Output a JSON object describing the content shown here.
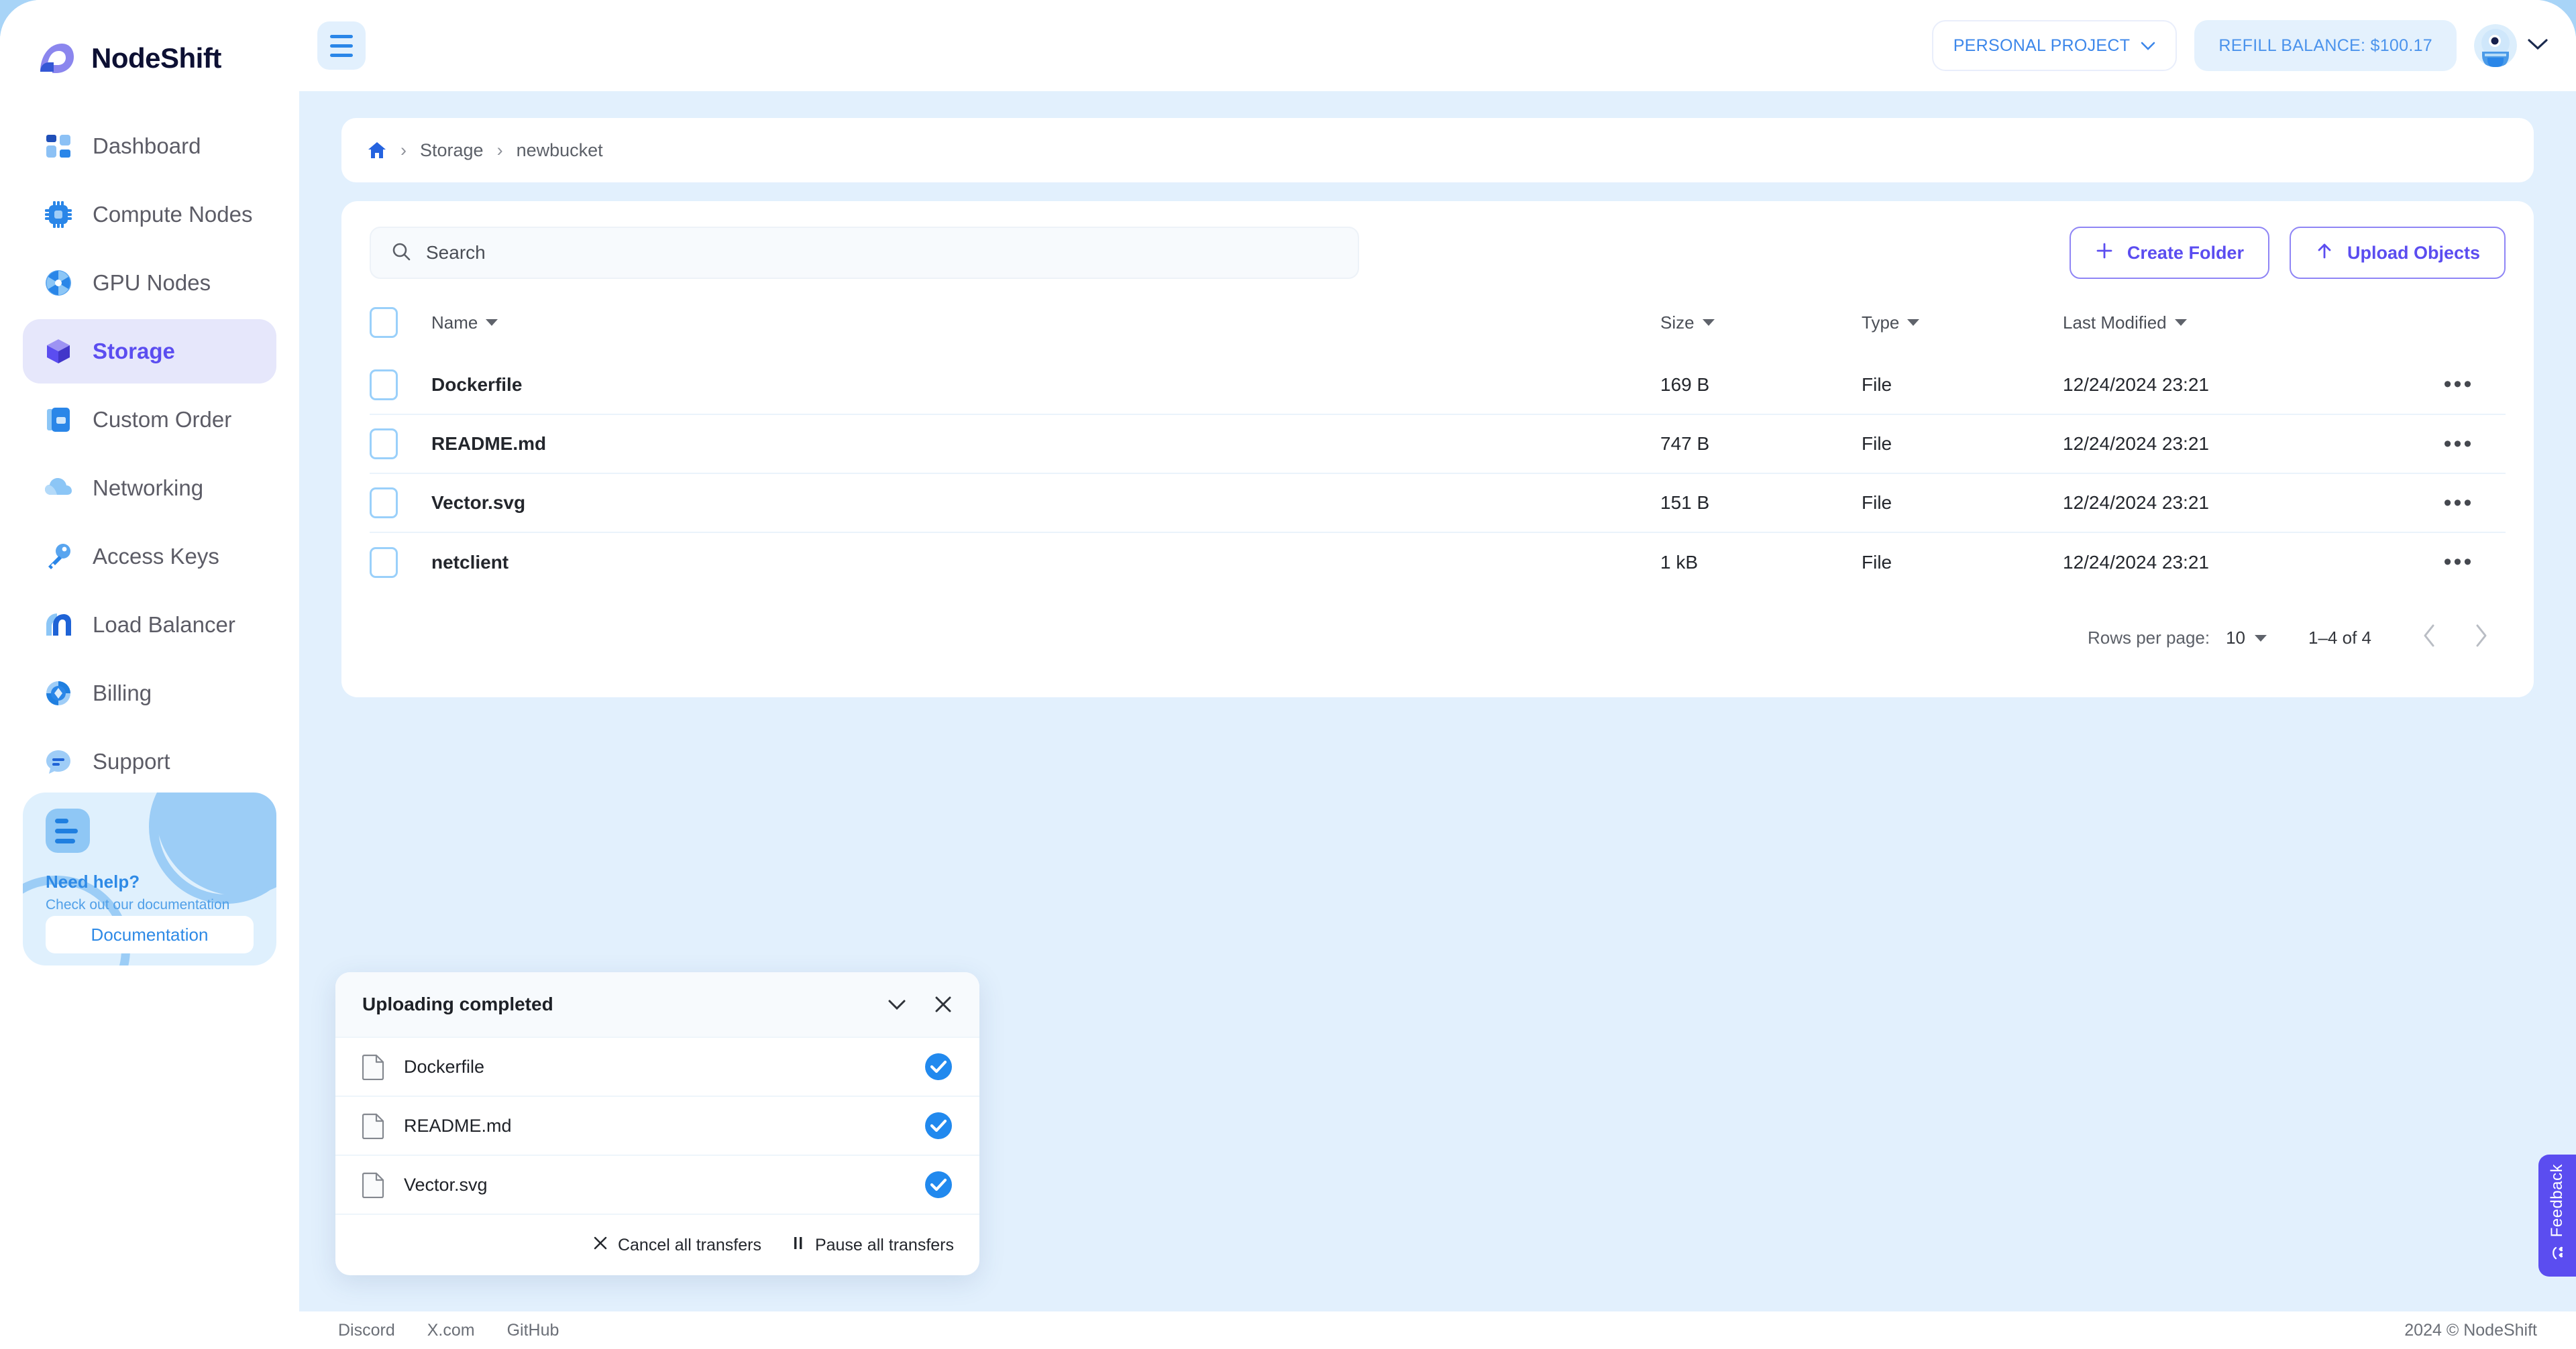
{
  "brand": {
    "name": "NodeShift",
    "accent": "#5b4df0",
    "blue": "#2a86e8"
  },
  "topbar": {
    "menu_icon": "hamburger-icon",
    "project_label": "PERSONAL PROJECT",
    "balance_label": "REFILL BALANCE: $100.17",
    "avatar_icon": "user-avatar",
    "chevron_icon": "chevron-down-icon"
  },
  "sidebar": {
    "items": [
      {
        "label": "Dashboard",
        "icon": "dashboard-icon",
        "active": false
      },
      {
        "label": "Compute Nodes",
        "icon": "cpu-icon",
        "active": false
      },
      {
        "label": "GPU Nodes",
        "icon": "gpu-fan-icon",
        "active": false
      },
      {
        "label": "Storage",
        "icon": "storage-cube-icon",
        "active": true
      },
      {
        "label": "Custom Order",
        "icon": "custom-order-icon",
        "active": false
      },
      {
        "label": "Networking",
        "icon": "cloud-icon",
        "active": false
      },
      {
        "label": "Access Keys",
        "icon": "key-icon",
        "active": false
      },
      {
        "label": "Load Balancer",
        "icon": "load-balancer-icon",
        "active": false
      },
      {
        "label": "Billing",
        "icon": "billing-icon",
        "active": false
      },
      {
        "label": "Support",
        "icon": "chat-support-icon",
        "active": false
      }
    ],
    "help": {
      "icon": "document-lines-icon",
      "title": "Need help?",
      "subtitle": "Check out our documentation",
      "button": "Documentation"
    }
  },
  "breadcrumb": {
    "home_icon": "home-icon",
    "separator": "›",
    "items": [
      "Storage",
      "newbucket"
    ]
  },
  "toolbar": {
    "search_placeholder": "Search",
    "search_value": "",
    "search_icon": "search-icon",
    "create_folder_label": "Create Folder",
    "create_folder_icon": "plus-icon",
    "upload_objects_label": "Upload Objects",
    "upload_objects_icon": "upload-arrow-icon"
  },
  "table": {
    "columns": [
      "Name",
      "Size",
      "Type",
      "Last Modified"
    ],
    "rows": [
      {
        "name": "Dockerfile",
        "size": "169 B",
        "type": "File",
        "modified": "12/24/2024 23:21"
      },
      {
        "name": "README.md",
        "size": "747 B",
        "type": "File",
        "modified": "12/24/2024 23:21"
      },
      {
        "name": "Vector.svg",
        "size": "151 B",
        "type": "File",
        "modified": "12/24/2024 23:21"
      },
      {
        "name": "netclient",
        "size": "1 kB",
        "type": "File",
        "modified": "12/24/2024 23:21"
      }
    ],
    "row_menu_icon": "more-options-icon"
  },
  "pagination": {
    "rows_per_page_label": "Rows per page:",
    "rows_per_page_value": "10",
    "range_label": "1–4 of 4",
    "prev_icon": "chevron-left-icon",
    "next_icon": "chevron-right-icon"
  },
  "uploader": {
    "title": "Uploading completed",
    "collapse_icon": "chevron-down-icon",
    "close_icon": "close-icon",
    "files": [
      {
        "name": "Dockerfile",
        "icon": "file-icon",
        "status_icon": "check-circle-icon"
      },
      {
        "name": "README.md",
        "icon": "file-icon",
        "status_icon": "check-circle-icon"
      },
      {
        "name": "Vector.svg",
        "icon": "file-icon",
        "status_icon": "check-circle-icon"
      }
    ],
    "cancel_label": "Cancel all transfers",
    "cancel_icon": "close-icon",
    "pause_label": "Pause all transfers",
    "pause_icon": "pause-icon"
  },
  "footer": {
    "links": [
      "Discord",
      "X.com",
      "GitHub"
    ],
    "copyright": "2024 © NodeShift"
  },
  "feedback": {
    "label": "Feedback",
    "icon": "smiley-hearts-icon"
  }
}
